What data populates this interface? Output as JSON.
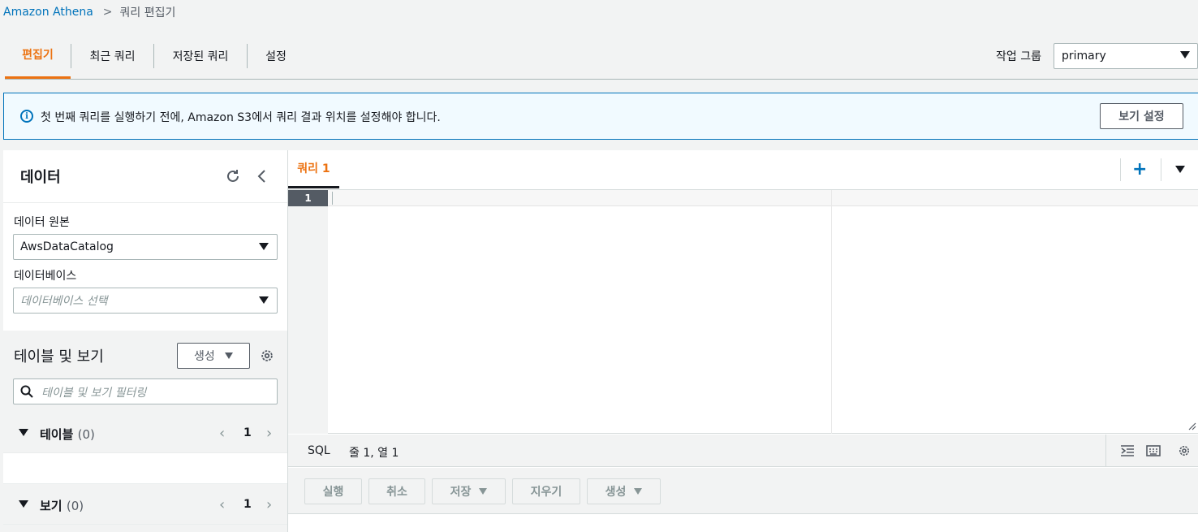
{
  "breadcrumb": {
    "root": "Amazon Athena",
    "current": "쿼리 편집기"
  },
  "tabs": [
    {
      "label": "편집기",
      "active": true
    },
    {
      "label": "최근 쿼리",
      "active": false
    },
    {
      "label": "저장된 쿼리",
      "active": false
    },
    {
      "label": "설정",
      "active": false
    }
  ],
  "workgroup": {
    "label": "작업 그룹",
    "value": "primary"
  },
  "flash": {
    "message": "첫 번째 쿼리를 실행하기 전에, Amazon S3에서 쿼리 결과 위치를 설정해야 합니다.",
    "button": "보기 설정"
  },
  "data_panel": {
    "title": "데이터",
    "source_label": "데이터 원본",
    "source_value": "AwsDataCatalog",
    "database_label": "데이터베이스",
    "database_placeholder": "데이터베이스 선택",
    "tables_title": "테이블 및 보기",
    "create_button": "생성",
    "filter_placeholder": "테이블 및 보기 필터링",
    "groups": [
      {
        "name": "테이블",
        "count": "(0)",
        "page": "1"
      },
      {
        "name": "보기",
        "count": "(0)",
        "page": "1"
      }
    ]
  },
  "editor": {
    "tab_label": "쿼리 1",
    "line_number": "1",
    "language": "SQL",
    "position": "줄 1, 열 1"
  },
  "actions": [
    {
      "label": "실행"
    },
    {
      "label": "취소"
    },
    {
      "label": "저장"
    },
    {
      "label": "지우기"
    },
    {
      "label": "생성"
    }
  ],
  "colors": {
    "accent": "#ec7211",
    "link": "#0073bb",
    "info_bg": "#f1faff"
  }
}
